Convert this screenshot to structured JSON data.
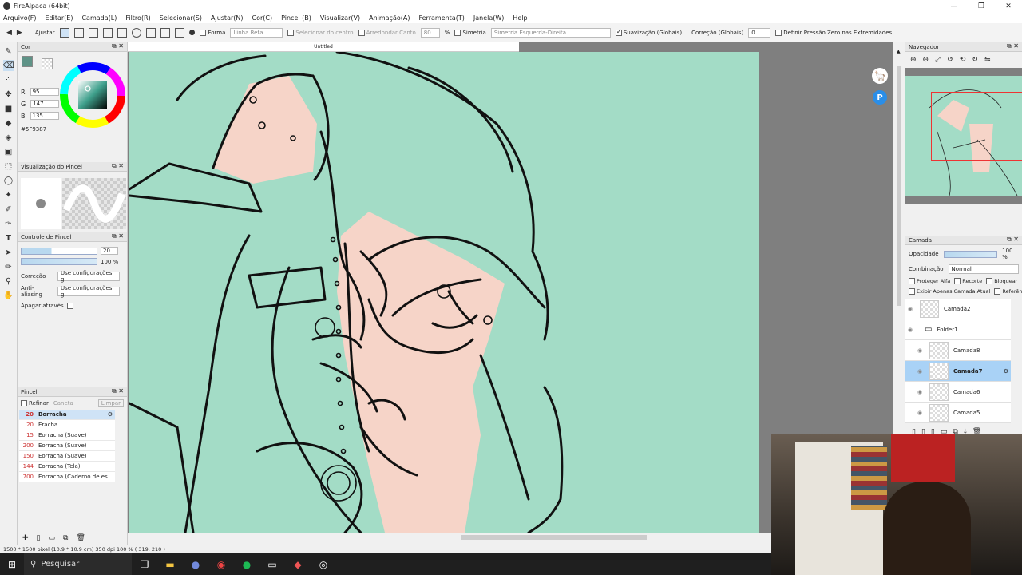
{
  "app": {
    "title": "FireAlpaca (64bit)",
    "canvas_title": "Untitled"
  },
  "menu": [
    "Arquivo(F)",
    "Editar(E)",
    "Camada(L)",
    "Filtro(R)",
    "Selecionar(S)",
    "Ajustar(N)",
    "Cor(C)",
    "Pincel (B)",
    "Visualizar(V)",
    "Animação(A)",
    "Ferramenta(T)",
    "Janela(W)",
    "Help"
  ],
  "toolbar": {
    "adjust_label": "Ajustar",
    "shape_label": "Forma",
    "shape_value": "Linha Reta",
    "select_center_label": "Selecionar do centro",
    "round_corner_label": "Arredondar Canto",
    "round_corner_value": "80",
    "percent": "%",
    "symmetry_label": "Simetria",
    "symmetry_value": "Simetria Esquerda-Direita",
    "smoothing_label": "Suavização (Globais)",
    "correction_label": "Correção (Globais)",
    "correction_value": "0",
    "pressure_label": "Definir Pressão Zero nas Extremidades"
  },
  "color_panel": {
    "title": "Cor",
    "r": "95",
    "g": "147",
    "b": "135",
    "hex": "#5F9387",
    "current_color": "#5f9387"
  },
  "brush_preview": {
    "title": "Visualização do Pincel"
  },
  "brush_control": {
    "title": "Controle de Pincel",
    "size_value": "20",
    "opacity_value": "100 %",
    "correction_label": "Correção",
    "correction_value": "Use configurações g",
    "antialias_label": "Anti-aliasing",
    "antialias_value": "Use configurações g",
    "erase_label": "Apagar através"
  },
  "brush_list": {
    "title": "Pincel",
    "refine": "Refinar",
    "pen": "Caneta",
    "clear": "Limpar",
    "items": [
      {
        "size": "20",
        "name": "Borracha",
        "selected": true
      },
      {
        "size": "20",
        "name": "Eracha"
      },
      {
        "size": "15",
        "name": "Eorracha (Suave)"
      },
      {
        "size": "200",
        "name": "Eorracha (Suave)"
      },
      {
        "size": "150",
        "name": "Eorracha (Suave)"
      },
      {
        "size": "144",
        "name": "Eorracha (Tela)"
      },
      {
        "size": "700",
        "name": "Eorracha (Caderno de es"
      }
    ]
  },
  "navigator": {
    "title": "Navegador"
  },
  "layers": {
    "title": "Camada",
    "opacity_label": "Opacidade",
    "opacity_value": "100 %",
    "blend_label": "Combinação",
    "blend_value": "Normal",
    "protect_alpha": "Proteger Alfa",
    "clipping": "Recorte",
    "lock": "Bloquear",
    "show_current_only": "Exibir Apenas Camada Atual",
    "reference": "Referência",
    "items": [
      {
        "name": "Camada2",
        "selected": false,
        "indent": 0,
        "folder": false
      },
      {
        "name": "Folder1",
        "selected": false,
        "indent": 0,
        "folder": true
      },
      {
        "name": "Camada8",
        "selected": false,
        "indent": 1,
        "folder": false
      },
      {
        "name": "Camada7",
        "selected": true,
        "indent": 1,
        "folder": false
      },
      {
        "name": "Camada6",
        "selected": false,
        "indent": 1,
        "folder": false
      },
      {
        "name": "Camada5",
        "selected": false,
        "indent": 1,
        "folder": false
      }
    ]
  },
  "status": {
    "text": "1500 * 1500 pixel  (10.9 * 10.9 cm)  350 dpi  100 %  ( 319, 210 )"
  },
  "taskbar": {
    "search_label": "Pesquisar"
  },
  "colors": {
    "canvas_fill": "#a3dcc6",
    "skin": "#f6d4c8",
    "accent_blue": "#cfe3f6"
  }
}
